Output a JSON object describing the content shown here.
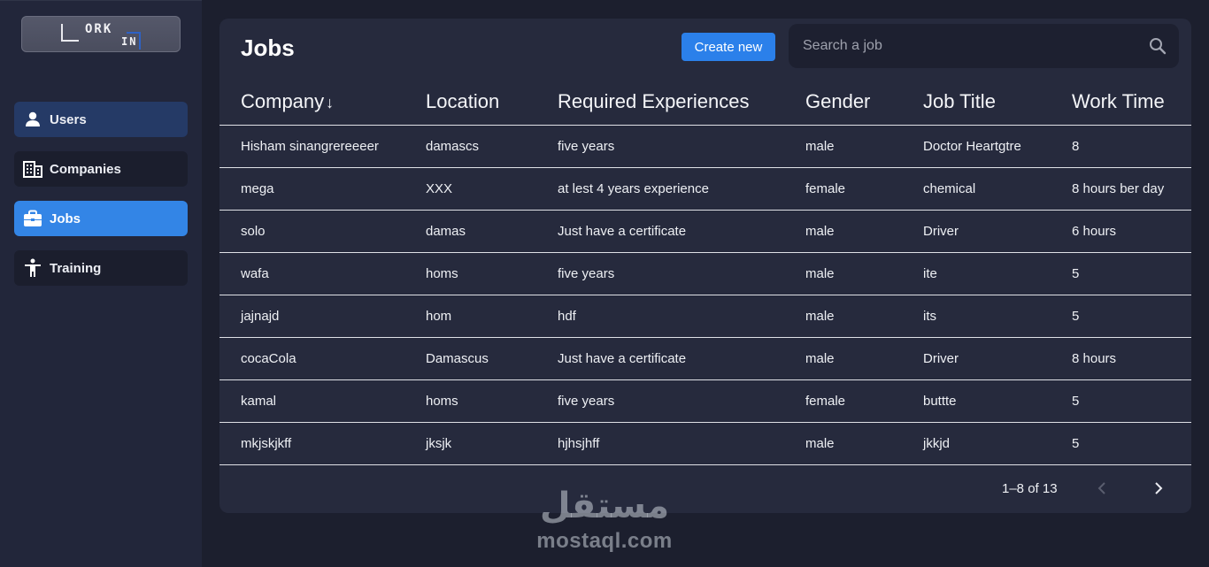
{
  "logo": {
    "line1": "ORK",
    "line2": "IN"
  },
  "sidebar": {
    "items": [
      {
        "label": "Users",
        "icon": "user-icon"
      },
      {
        "label": "Companies",
        "icon": "building-icon"
      },
      {
        "label": "Jobs",
        "icon": "briefcase-icon",
        "active": true
      },
      {
        "label": "Training",
        "icon": "person-stretch-icon"
      }
    ]
  },
  "page": {
    "title": "Jobs",
    "create_label": "Create new",
    "search_placeholder": "Search a job"
  },
  "table": {
    "columns": [
      "Company",
      "Location",
      "Required Experiences",
      "Gender",
      "Job Title",
      "Work Time"
    ],
    "sort": {
      "column": "Company",
      "direction": "descending",
      "indicator": "↓"
    },
    "rows": [
      [
        "Hisham sinangrereeeer",
        "damascs",
        "five years",
        "male",
        "Doctor Heartgtre",
        "8"
      ],
      [
        "mega",
        "XXX",
        "at lest 4 years experience",
        "female",
        "chemical",
        "8 hours ber day"
      ],
      [
        "solo",
        "damas",
        "Just have a certificate",
        "male",
        "Driver",
        "6 hours"
      ],
      [
        "wafa",
        "homs",
        "five years",
        "male",
        "ite",
        "5"
      ],
      [
        "jajnajd",
        "hom",
        "hdf",
        "male",
        "its",
        "5"
      ],
      [
        "cocaCola",
        "Damascus",
        "Just have a certificate",
        "male",
        "Driver",
        "8 hours"
      ],
      [
        "kamal",
        "homs",
        "five years",
        "female",
        "buttte",
        "5"
      ],
      [
        "mkjskjkff",
        "jksjk",
        "hjhsjhff",
        "male",
        "jkkjd",
        "5"
      ]
    ]
  },
  "pagination": {
    "range_text": "1–8 of 13"
  },
  "watermark": {
    "arabic": "مستقل",
    "latin": "mostaql.com"
  },
  "colors": {
    "background": "#1c1f2e",
    "sidebar": "#22263a",
    "card": "#262a3d",
    "accent": "#2b80ea",
    "nav_active": "#3385e6",
    "nav_users": "#253a66"
  }
}
